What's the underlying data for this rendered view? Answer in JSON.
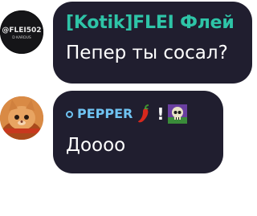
{
  "messages": [
    {
      "author": "[Kotik]FLEI Флей",
      "avatar_text_top": "@FLEI502",
      "avatar_text_bottom": "D KARDUS",
      "text": "Пепер ты сосал?"
    },
    {
      "author": "PEPPER",
      "badge_symbol": "!",
      "text": "Доооо"
    }
  ],
  "colors": {
    "bubble": "#201e2f",
    "author1": "#2ec4a7",
    "author2": "#6fc3f2",
    "text": "#ffffff"
  },
  "icons": [
    "badge-dot-icon",
    "chili-pepper-icon",
    "skull-icon"
  ]
}
